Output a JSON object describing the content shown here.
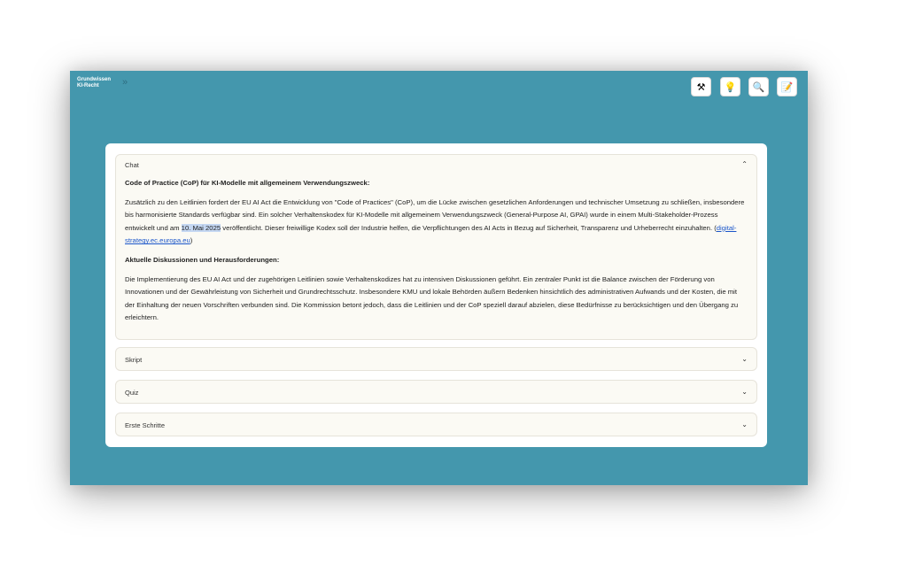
{
  "app": {
    "brand_line1": "Grundwissen",
    "brand_line2": "KI-Recht",
    "collapse_icon": "»"
  },
  "toolbar": {
    "buttons": [
      {
        "icon": "⚒",
        "name": "tools-icon"
      },
      {
        "icon": "💡",
        "name": "lightbulb-icon"
      },
      {
        "icon": "🔍",
        "name": "magnifier-icon"
      },
      {
        "icon": "📝",
        "name": "memo-icon"
      }
    ]
  },
  "accordion": {
    "chat": {
      "title": "Chat",
      "heading1": "Code of Practice (CoP) für KI-Modelle mit allgemeinem Verwendungszweck:",
      "p1_before": "Zusätzlich zu den Leitlinien fordert der EU AI Act die Entwicklung von \"Code of Practices\" (CoP), um die Lücke zwischen gesetzlichen Anforderungen und technischer Umsetzung zu schließen, insbesondere bis harmonisierte Standards verfügbar sind. Ein solcher Verhaltenskodex für KI-Modelle mit allgemeinem Verwendungszweck (General-Purpose AI, GPAI) wurde in einem Multi-Stakeholder-Prozess entwickelt und am ",
      "p1_highlight": "10. Mai 2025",
      "p1_after": " veröffentlicht. Dieser freiwillige Kodex soll der Industrie helfen, die Verpflichtungen des AI Acts in Bezug auf Sicherheit, Transparenz und Urheberrecht einzuhalten. (",
      "p1_link": "digital-strategy.ec.europa.eu",
      "p1_end": ")",
      "heading2": "Aktuelle Diskussionen und Herausforderungen:",
      "p2": "Die Implementierung des EU AI Act und der zugehörigen Leitlinien sowie Verhaltenskodizes hat zu intensiven Diskussionen geführt. Ein zentraler Punkt ist die Balance zwischen der Förderung von Innovationen und der Gewährleistung von Sicherheit und Grundrechtsschutz. Insbesondere KMU und lokale Behörden äußern Bedenken hinsichtlich des administrativen Aufwands und der Kosten, die mit der Einhaltung der neuen Vorschriften verbunden sind. Die Kommission betont jedoch, dass die Leitlinien und der CoP speziell darauf abzielen, diese Bedürfnisse zu berücksichtigen und den Übergang zu erleichtern.",
      "chevron": "⌃"
    },
    "skript": {
      "title": "Skript",
      "chevron": "⌄"
    },
    "quiz": {
      "title": "Quiz",
      "chevron": "⌄"
    },
    "erste_schritte": {
      "title": "Erste Schritte",
      "chevron": "⌄"
    }
  }
}
